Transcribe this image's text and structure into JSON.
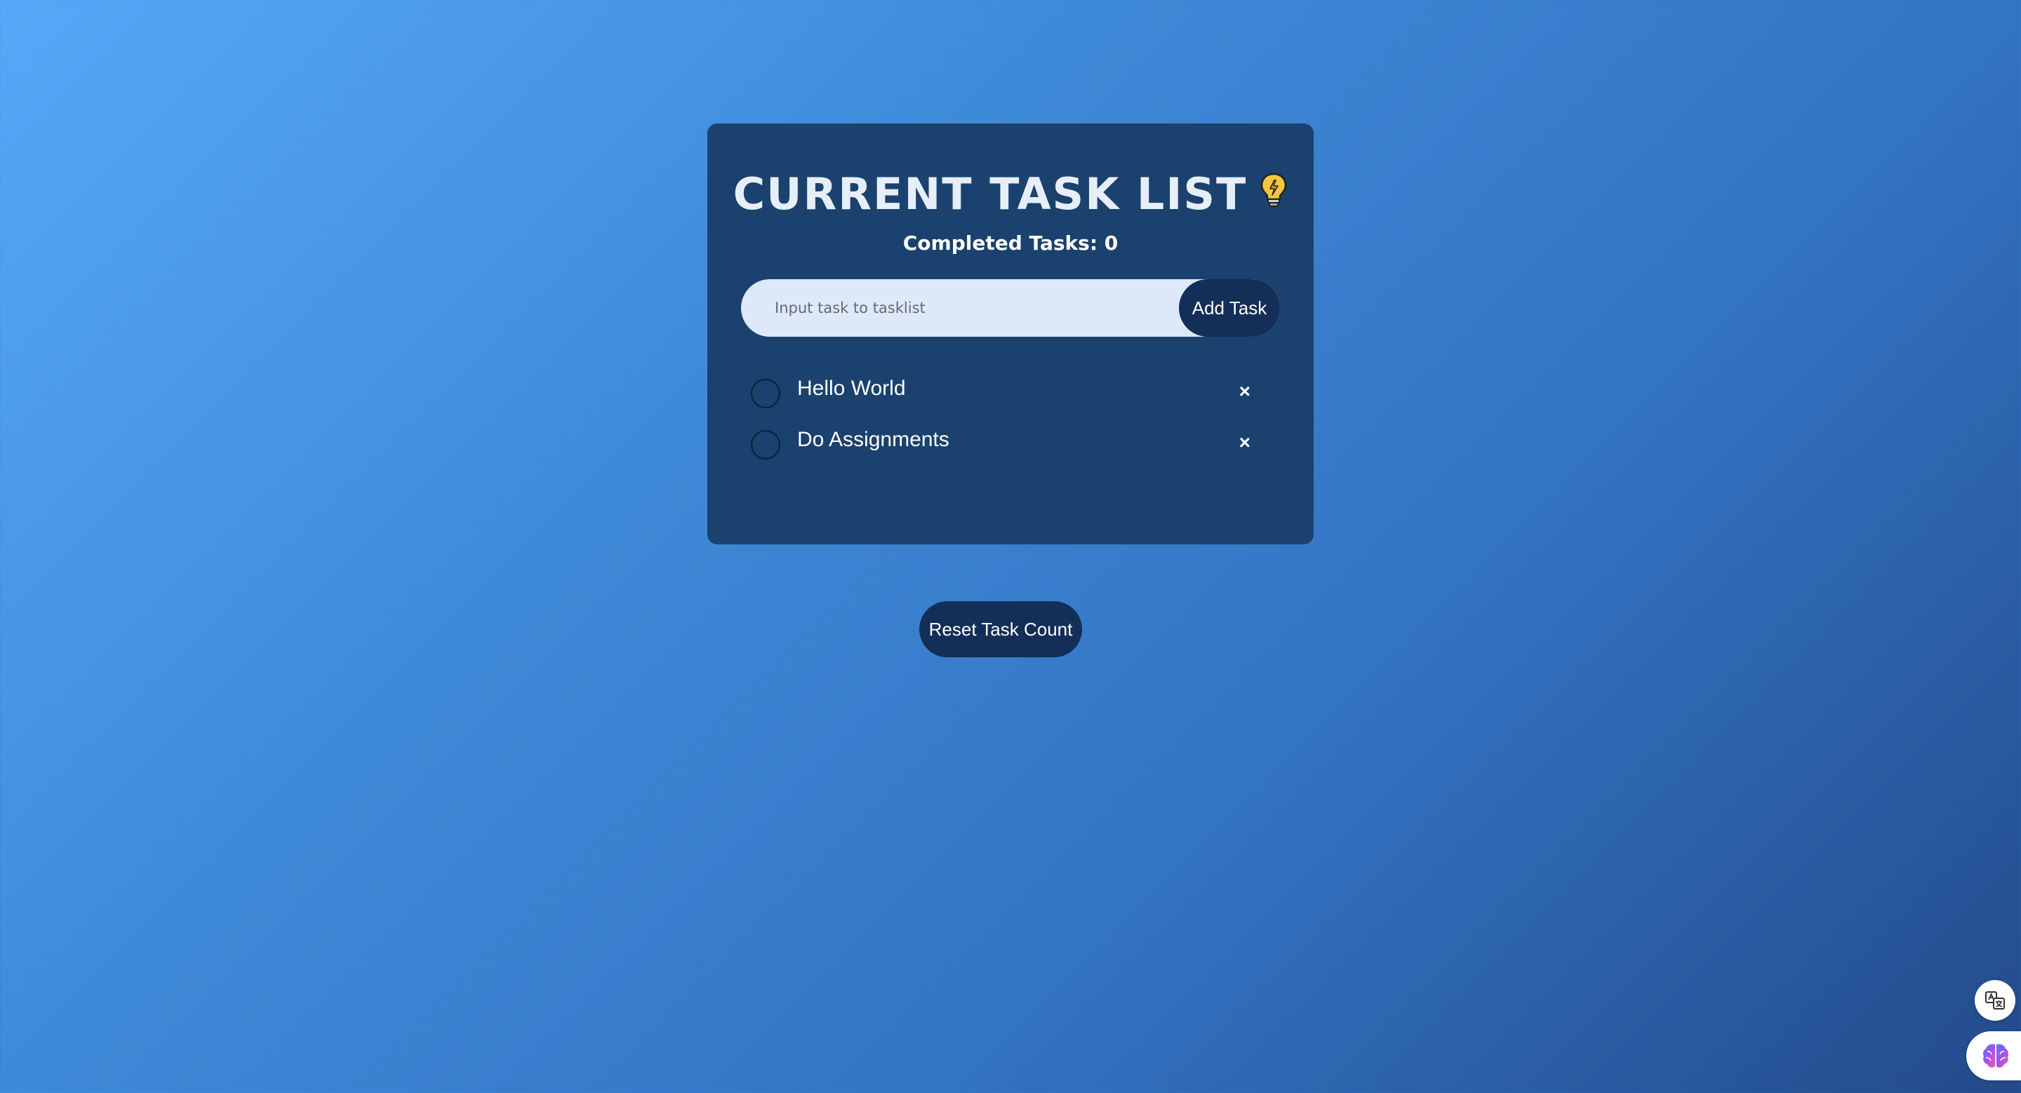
{
  "app": {
    "title": "CURRENT TASK LIST",
    "title_icon": "lightbulb-icon"
  },
  "stats": {
    "completed_label": "Completed Tasks: 0"
  },
  "add_form": {
    "placeholder": "Input task to tasklist",
    "value": "",
    "button_label": "Add Task"
  },
  "tasks": [
    {
      "label": "Hello World",
      "completed": false,
      "delete_symbol": "×"
    },
    {
      "label": "Do Assignments",
      "completed": false,
      "delete_symbol": "×"
    }
  ],
  "footer": {
    "reset_label": "Reset Task Count"
  },
  "floating_widgets": [
    {
      "icon": "translate-icon"
    },
    {
      "icon": "brain-icon"
    }
  ],
  "colors": {
    "card_bg": "#1b416e",
    "button_bg": "#132e57",
    "input_bg": "#dde9f9",
    "title_text": "#e6eff9",
    "gradient_start": "#55a9f8",
    "gradient_end": "#234a8a"
  }
}
